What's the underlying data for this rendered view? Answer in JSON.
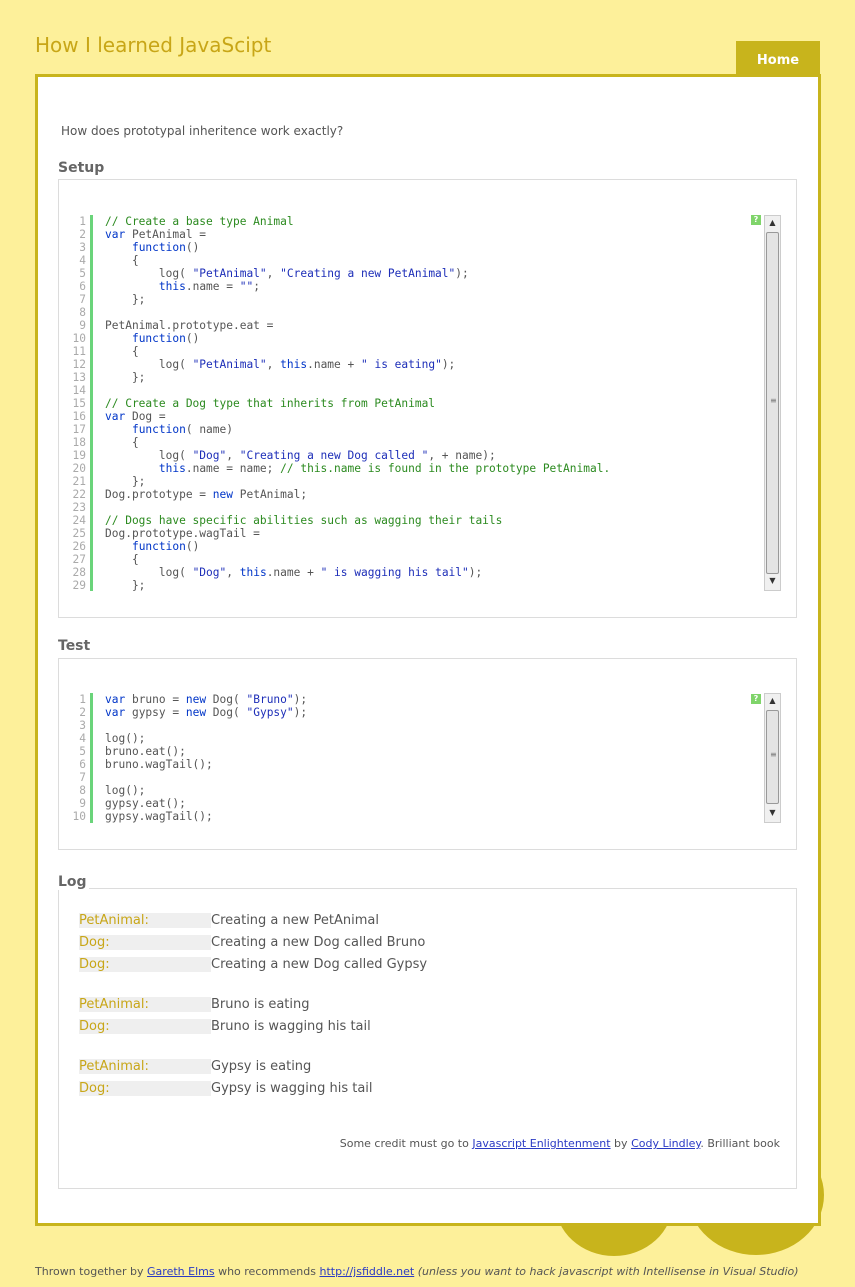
{
  "header": {
    "title": "How I learned JavaScipt",
    "home_tab": "Home"
  },
  "question": "How does prototypal inheritence work exactly?",
  "setup": {
    "legend": "Setup",
    "help": "?",
    "lines": [
      [
        [
          "cm",
          "// Create a base type Animal"
        ]
      ],
      [
        [
          "kw",
          "var"
        ],
        [
          "",
          "PetAnimal ="
        ]
      ],
      [
        [
          "",
          "    "
        ],
        [
          "kw",
          "function"
        ],
        [
          "",
          "()"
        ]
      ],
      [
        [
          "",
          "    {"
        ]
      ],
      [
        [
          "",
          "        log( "
        ],
        [
          "str",
          "\"PetAnimal\""
        ],
        [
          "",
          ", "
        ],
        [
          "str",
          "\"Creating a new PetAnimal\""
        ],
        [
          "",
          ");"
        ]
      ],
      [
        [
          "",
          "        "
        ],
        [
          "kw",
          "this"
        ],
        [
          "",
          ".name = "
        ],
        [
          "str",
          "\"\""
        ],
        [
          "",
          ";"
        ]
      ],
      [
        [
          "",
          "    };"
        ]
      ],
      [
        [
          "",
          ""
        ]
      ],
      [
        [
          "",
          "PetAnimal.prototype.eat ="
        ]
      ],
      [
        [
          "",
          "    "
        ],
        [
          "kw",
          "function"
        ],
        [
          "",
          "()"
        ]
      ],
      [
        [
          "",
          "    {"
        ]
      ],
      [
        [
          "",
          "        log( "
        ],
        [
          "str",
          "\"PetAnimal\""
        ],
        [
          "",
          ", "
        ],
        [
          "kw",
          "this"
        ],
        [
          "",
          ".name + "
        ],
        [
          "str",
          "\" is eating\""
        ],
        [
          "",
          ");"
        ]
      ],
      [
        [
          "",
          "    };"
        ]
      ],
      [
        [
          "",
          ""
        ]
      ],
      [
        [
          "cm",
          "// Create a Dog type that inherits from PetAnimal"
        ]
      ],
      [
        [
          "kw",
          "var"
        ],
        [
          "",
          "Dog ="
        ]
      ],
      [
        [
          "",
          "    "
        ],
        [
          "kw",
          "function"
        ],
        [
          "",
          "( name)"
        ]
      ],
      [
        [
          "",
          "    {"
        ]
      ],
      [
        [
          "",
          "        log( "
        ],
        [
          "str",
          "\"Dog\""
        ],
        [
          "",
          ", "
        ],
        [
          "str",
          "\"Creating a new Dog called \""
        ],
        [
          "",
          ", + name);"
        ]
      ],
      [
        [
          "",
          "        "
        ],
        [
          "kw",
          "this"
        ],
        [
          "",
          ".name = name; "
        ],
        [
          "cm",
          "// this.name is found in the prototype PetAnimal."
        ]
      ],
      [
        [
          "",
          "    };"
        ]
      ],
      [
        [
          "",
          "Dog.prototype = "
        ],
        [
          "kw",
          "new"
        ],
        [
          "",
          " PetAnimal;"
        ]
      ],
      [
        [
          "",
          ""
        ]
      ],
      [
        [
          "cm",
          "// Dogs have specific abilities such as wagging their tails"
        ]
      ],
      [
        [
          "",
          "Dog.prototype.wagTail ="
        ]
      ],
      [
        [
          "",
          "    "
        ],
        [
          "kw",
          "function"
        ],
        [
          "",
          "()"
        ]
      ],
      [
        [
          "",
          "    {"
        ]
      ],
      [
        [
          "",
          "        log( "
        ],
        [
          "str",
          "\"Dog\""
        ],
        [
          "",
          ", "
        ],
        [
          "kw",
          "this"
        ],
        [
          "",
          ".name + "
        ],
        [
          "str",
          "\" is wagging his tail\""
        ],
        [
          "",
          ");"
        ]
      ],
      [
        [
          "",
          "    };"
        ]
      ]
    ]
  },
  "test": {
    "legend": "Test",
    "help": "?",
    "lines": [
      [
        [
          "kw",
          "var"
        ],
        [
          "",
          "bruno = "
        ],
        [
          "kw",
          "new"
        ],
        [
          "",
          " Dog( "
        ],
        [
          "str",
          "\"Bruno\""
        ],
        [
          "",
          ");"
        ]
      ],
      [
        [
          "kw",
          "var"
        ],
        [
          "",
          "gypsy = "
        ],
        [
          "kw",
          "new"
        ],
        [
          "",
          " Dog( "
        ],
        [
          "str",
          "\"Gypsy\""
        ],
        [
          "",
          ");"
        ]
      ],
      [
        [
          "",
          ""
        ]
      ],
      [
        [
          "",
          "log();"
        ]
      ],
      [
        [
          "",
          "bruno.eat();"
        ]
      ],
      [
        [
          "",
          "bruno.wagTail();"
        ]
      ],
      [
        [
          "",
          ""
        ]
      ],
      [
        [
          "",
          "log();"
        ]
      ],
      [
        [
          "",
          "gypsy.eat();"
        ]
      ],
      [
        [
          "",
          "gypsy.wagTail();"
        ]
      ]
    ]
  },
  "log": {
    "legend": "Log",
    "entries": [
      {
        "cat": "PetAnimal:",
        "msg": "Creating a new PetAnimal"
      },
      {
        "cat": "Dog:",
        "msg": "Creating a new Dog called Bruno"
      },
      {
        "cat": "Dog:",
        "msg": "Creating a new Dog called Gypsy"
      },
      {
        "cat": "PetAnimal:",
        "msg": "Bruno is eating"
      },
      {
        "cat": "Dog:",
        "msg": "Bruno is wagging his tail"
      },
      {
        "cat": "PetAnimal:",
        "msg": "Gypsy is eating"
      },
      {
        "cat": "Dog:",
        "msg": "Gypsy is wagging his tail"
      }
    ],
    "credit": {
      "prefix": "Some credit must go to ",
      "link1": "Javascript Enlightenment",
      "mid": " by ",
      "link2": "Cody Lindley",
      "suffix": ". Brilliant book"
    }
  },
  "footer": {
    "prefix": "Thrown together by ",
    "author": "Gareth Elms",
    "mid": " who recommends ",
    "link": "http://jsfiddle.net",
    "note": " (unless you want to hack javascript with Intellisense in Visual Studio)"
  }
}
